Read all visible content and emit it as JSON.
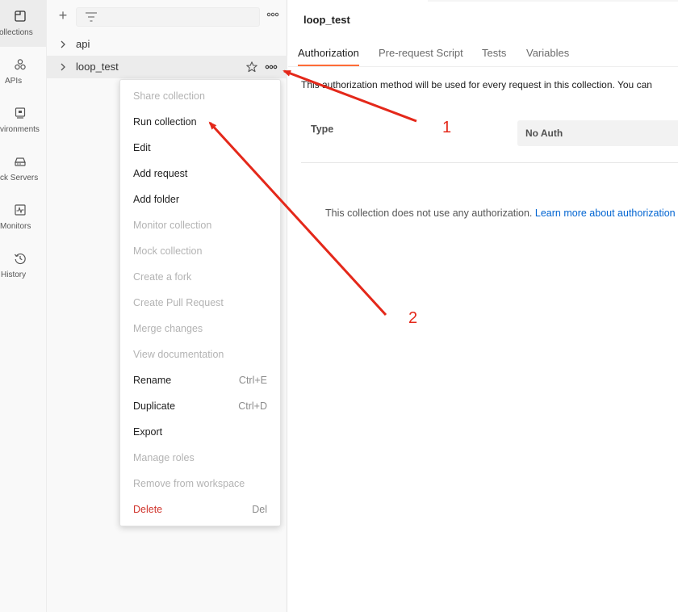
{
  "rail": {
    "items": [
      {
        "label": "ollections",
        "icon": "collections-icon"
      },
      {
        "label": "APIs",
        "icon": "apis-icon"
      },
      {
        "label": "vironments",
        "icon": "environments-icon"
      },
      {
        "label": "ck Servers",
        "icon": "mock-servers-icon"
      },
      {
        "label": "Monitors",
        "icon": "monitors-icon"
      },
      {
        "label": "History",
        "icon": "history-icon"
      }
    ]
  },
  "sidebar": {
    "search_placeholder": "",
    "tree": [
      {
        "label": "api"
      },
      {
        "label": "loop_test"
      }
    ]
  },
  "context_menu": {
    "items": [
      {
        "label": "Share collection",
        "shortcut": "",
        "state": "disabled"
      },
      {
        "label": "Run collection",
        "shortcut": "",
        "state": "enabled"
      },
      {
        "label": "Edit",
        "shortcut": "",
        "state": "enabled"
      },
      {
        "label": "Add request",
        "shortcut": "",
        "state": "enabled"
      },
      {
        "label": "Add folder",
        "shortcut": "",
        "state": "enabled"
      },
      {
        "label": "Monitor collection",
        "shortcut": "",
        "state": "disabled"
      },
      {
        "label": "Mock collection",
        "shortcut": "",
        "state": "disabled"
      },
      {
        "label": "Create a fork",
        "shortcut": "",
        "state": "disabled"
      },
      {
        "label": "Create Pull Request",
        "shortcut": "",
        "state": "disabled"
      },
      {
        "label": "Merge changes",
        "shortcut": "",
        "state": "disabled"
      },
      {
        "label": "View documentation",
        "shortcut": "",
        "state": "disabled"
      },
      {
        "label": "Rename",
        "shortcut": "Ctrl+E",
        "state": "enabled"
      },
      {
        "label": "Duplicate",
        "shortcut": "Ctrl+D",
        "state": "enabled"
      },
      {
        "label": "Export",
        "shortcut": "",
        "state": "enabled"
      },
      {
        "label": "Manage roles",
        "shortcut": "",
        "state": "disabled"
      },
      {
        "label": "Remove from workspace",
        "shortcut": "",
        "state": "disabled"
      },
      {
        "label": "Delete",
        "shortcut": "Del",
        "state": "danger"
      }
    ]
  },
  "main": {
    "title": "loop_test",
    "tabs": [
      {
        "label": "Authorization",
        "active": true
      },
      {
        "label": "Pre-request Script",
        "active": false
      },
      {
        "label": "Tests",
        "active": false
      },
      {
        "label": "Variables",
        "active": false
      }
    ],
    "description": "This authorization method will be used for every request in this collection. You can",
    "type_label": "Type",
    "auth_value": "No Auth",
    "noauth_text": "This collection does not use any authorization.",
    "noauth_link": "Learn more about authorization"
  },
  "annotations": {
    "labels": [
      "1",
      "2"
    ],
    "color": "#e4281a"
  },
  "colors": {
    "accent": "#ff6c37",
    "link": "#0265d2",
    "danger": "#d0342c"
  }
}
